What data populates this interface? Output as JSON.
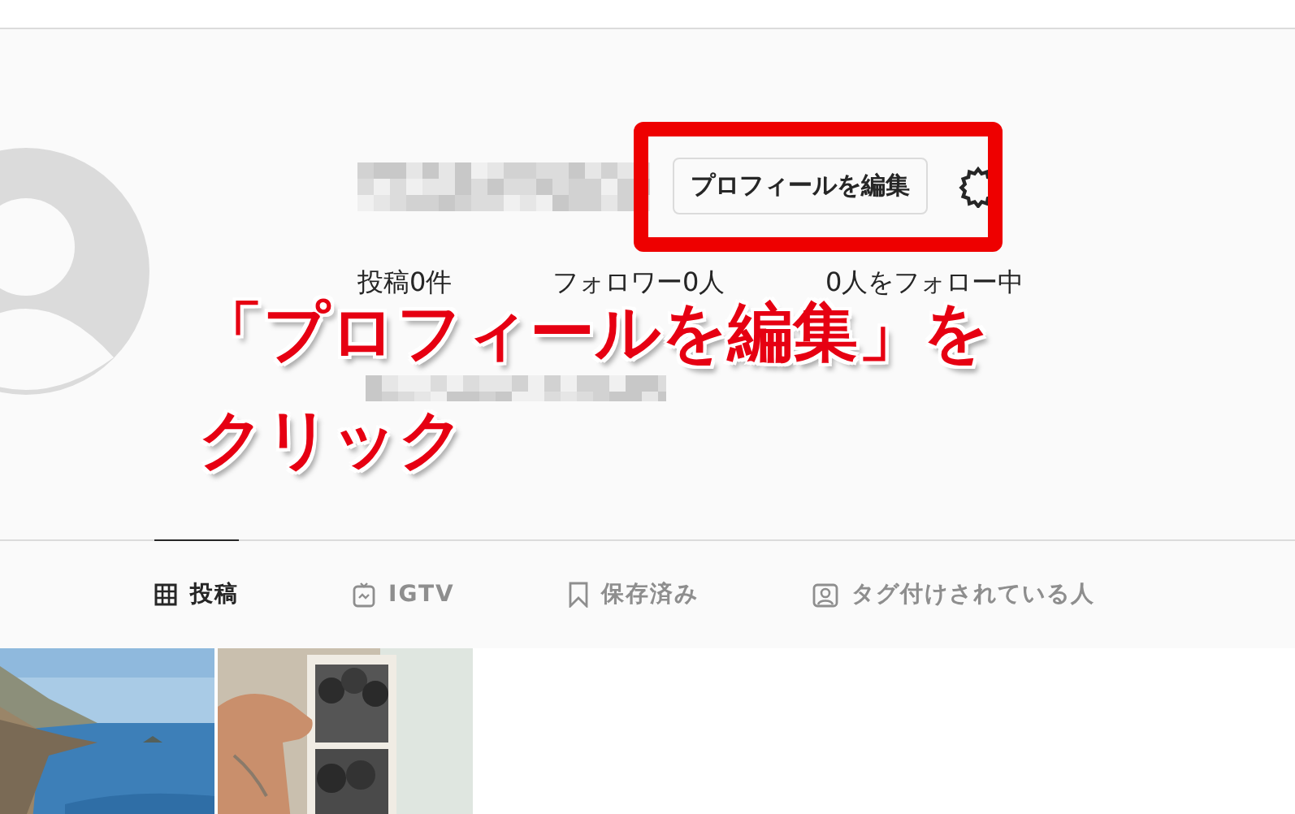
{
  "profile": {
    "edit_button": "プロフィールを編集",
    "stats": [
      "投稿0件",
      "フォロワー0人",
      "0人をフォロー中"
    ]
  },
  "tabs": [
    {
      "label": "投稿",
      "kind": "grid",
      "selected": true
    },
    {
      "label": "IGTV",
      "kind": "tv",
      "selected": false
    },
    {
      "label": "保存済み",
      "kind": "bookmark",
      "selected": false
    },
    {
      "label": "タグ付けされている人",
      "kind": "tag",
      "selected": false
    }
  ],
  "annotation": {
    "lines": [
      "「プロフィールを編集」を",
      "クリック"
    ]
  }
}
